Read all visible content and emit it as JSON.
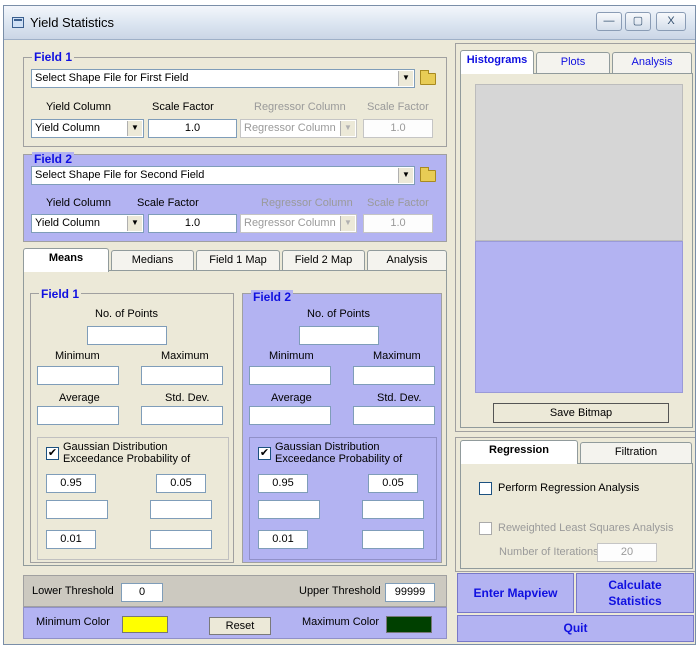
{
  "window": {
    "title": "Yield Statistics",
    "controls": [
      "—",
      "▢",
      "X"
    ]
  },
  "field1": {
    "legend": "Field 1",
    "shape_file": "Select Shape File for First Field",
    "yield_column_label": "Yield Column",
    "scale_factor_label": "Scale Factor",
    "regressor_column_label": "Regressor Column",
    "regressor_scale_label": "Scale Factor",
    "yield_column_value": "Yield Column",
    "scale_factor_value": "1.0",
    "regressor_column_value": "Regressor Column",
    "regressor_scale_value": "1.0"
  },
  "field2": {
    "legend": "Field 2",
    "shape_file": "Select Shape File for Second Field",
    "yield_column_label": "Yield Column",
    "scale_factor_label": "Scale Factor",
    "regressor_column_label": "Regressor Column",
    "regressor_scale_label": "Scale Factor",
    "yield_column_value": "Yield Column",
    "scale_factor_value": "1.0",
    "regressor_column_value": "Regressor Column",
    "regressor_scale_value": "1.0"
  },
  "stats_tabs": [
    "Means",
    "Medians",
    "Field 1 Map",
    "Field 2 Map",
    "Analysis"
  ],
  "means": {
    "field1": {
      "legend": "Field 1",
      "no_points": "No. of Points",
      "minimum": "Minimum",
      "maximum": "Maximum",
      "average": "Average",
      "std_dev": "Std. Dev.",
      "gaussian_line1": "Gaussian Distribution",
      "gaussian_line2": "Exceedance Probability of",
      "checked": "✔",
      "p1": "0.95",
      "p2": "0.05",
      "p3": "0.01"
    },
    "field2": {
      "legend": "Field 2",
      "no_points": "No. of Points",
      "minimum": "Minimum",
      "maximum": "Maximum",
      "average": "Average",
      "std_dev": "Std. Dev.",
      "gaussian_line1": "Gaussian Distribution",
      "gaussian_line2": "Exceedance Probability of",
      "checked": "✔",
      "p1": "0.95",
      "p2": "0.05",
      "p3": "0.01"
    }
  },
  "thresholds": {
    "lower_label": "Lower Threshold",
    "lower_value": "0",
    "upper_label": "Upper Threshold",
    "upper_value": "99999"
  },
  "colors": {
    "min_label": "Minimum Color",
    "max_label": "Maximum Color",
    "reset_label": "Reset",
    "min_color": "#ffff00",
    "max_color": "#004000"
  },
  "right_tabs": [
    "Histograms",
    "Plots",
    "Analysis"
  ],
  "save_bitmap": "Save Bitmap",
  "reg_tabs": [
    "Regression",
    "Filtration"
  ],
  "regression": {
    "perform_label": "Perform Regression Analysis",
    "reweighted_label": "Reweighted Least Squares Analysis",
    "iterations_label": "Number of Iterations",
    "iterations_value": "20"
  },
  "buttons": {
    "enter_mapview": "Enter Mapview",
    "calc_line1": "Calculate",
    "calc_line2": "Statistics",
    "quit": "Quit"
  }
}
